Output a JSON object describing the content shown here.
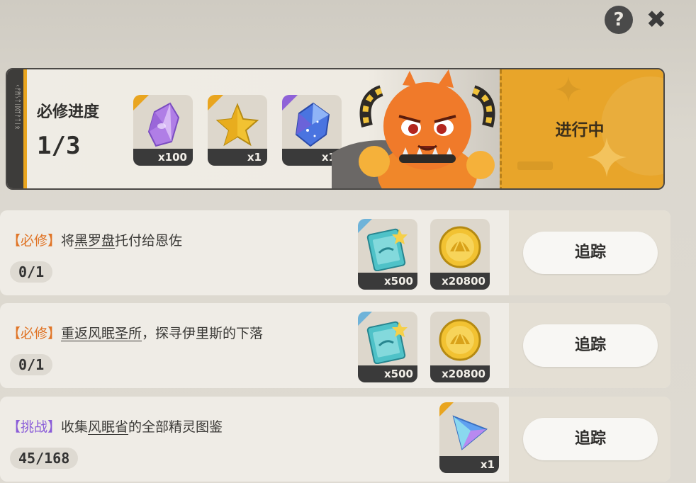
{
  "top_icons": {
    "help": "?",
    "close": "✖"
  },
  "header": {
    "rune_text": "ᚲᚠᛗᛊᛏᛁᛞᛉᚨᛏᛁᛟ",
    "title": "必修进度",
    "progress": "1/3",
    "rewards": [
      {
        "icon": "purple-crystal-icon",
        "qty": "x100",
        "corner": "orange"
      },
      {
        "icon": "gold-star-icon",
        "qty": "x1",
        "corner": "orange"
      },
      {
        "icon": "blue-gem-icon",
        "qty": "x1",
        "corner": "purple"
      }
    ],
    "status": "进行中"
  },
  "tasks": [
    {
      "tag": "【必修】",
      "tag_type": "required",
      "text_plain_before": "将",
      "text_underlined": "黑罗盘",
      "text_plain_after": "托付给恩佐",
      "progress": "0/1",
      "rewards": [
        {
          "icon": "ticket-icon",
          "qty": "x500"
        },
        {
          "icon": "gold-coin-icon",
          "qty": "x20800"
        }
      ],
      "button": "追踪"
    },
    {
      "tag": "【必修】",
      "tag_type": "required",
      "text_plain_before": "",
      "text_underlined": "重返风眠圣所",
      "text_plain_after": "，探寻伊里斯的下落",
      "progress": "0/1",
      "rewards": [
        {
          "icon": "ticket-icon",
          "qty": "x500"
        },
        {
          "icon": "gold-coin-icon",
          "qty": "x20800"
        }
      ],
      "button": "追踪"
    },
    {
      "tag": "【挑战】",
      "tag_type": "challenge",
      "text_plain_before": "收集",
      "text_underlined": "风眠省",
      "text_plain_after": "的全部精灵图鉴",
      "progress": "45/168",
      "rewards": [
        {
          "icon": "prism-gem-icon",
          "qty": "x1"
        }
      ],
      "button": "追踪"
    }
  ]
}
